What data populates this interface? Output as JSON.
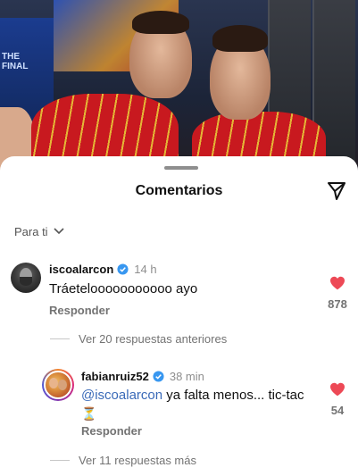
{
  "photo": {
    "banner_text": "THE FINAL"
  },
  "sheet": {
    "title": "Comentarios",
    "share_icon": "send-icon",
    "sort": {
      "label": "Para ti",
      "icon": "chevron-down-icon"
    }
  },
  "comments": [
    {
      "username": "iscoalarcon",
      "verified": true,
      "time": "14 h",
      "text": "Tráetelooooooooooo ayo",
      "reply_label": "Responder",
      "likes": "878",
      "liked": true,
      "thread_label": "Ver 20 respuestas anteriores"
    }
  ],
  "reply": {
    "username": "fabianruiz52",
    "verified": true,
    "time": "38 min",
    "mention": "@iscoalarcon",
    "text": " ya falta menos... tic-tac",
    "emoji": "⏳",
    "reply_label": "Responder",
    "likes": "54",
    "liked": true,
    "more_label": "Ver 11 respuestas más"
  },
  "colors": {
    "like_red": "#ed4956",
    "verified_blue": "#3897f0",
    "mention_blue": "#3a6ab8"
  }
}
